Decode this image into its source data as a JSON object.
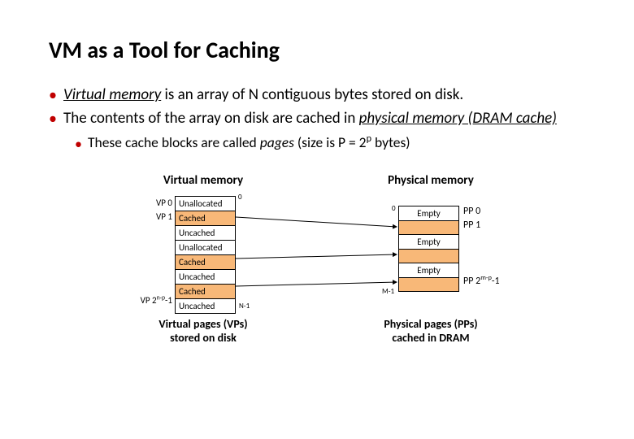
{
  "title": "VM as a Tool for Caching",
  "bullets": {
    "b1_pre": "Virtual memory",
    "b1_post": " is an array of N contiguous bytes stored on disk.",
    "b2_pre": "The contents of the array on disk are cached in ",
    "b2_em": "physical memory (DRAM cache)",
    "sub1_pre": "These cache blocks are called ",
    "sub1_em": "pages",
    "sub1_post": " (size is P = 2",
    "sub1_sup": "p",
    "sub1_end": " bytes)"
  },
  "diagram": {
    "vm_head": "Virtual memory",
    "pm_head": "Physical memory",
    "vp0": "VP 0",
    "vp1": "VP 1",
    "vplast_a": "VP 2",
    "vplast_sup": "n-p",
    "vplast_b": "-1",
    "vm_rows": {
      "r0": "Unallocated",
      "r1": "Cached",
      "r2": "Uncached",
      "r3": "Unallocated",
      "r4": "Cached",
      "r5": "Uncached",
      "r6": "Cached",
      "r7": "Uncached"
    },
    "pm_rows": {
      "r0": "Empty",
      "r2": "Empty",
      "r4": "Empty"
    },
    "pp0": "PP 0",
    "pp1": "PP 1",
    "pplast_a": "PP 2",
    "pplast_sup": "m-p",
    "pplast_b": "-1",
    "zero": "0",
    "n1": "N-1",
    "m1": "M-1",
    "vm_caption_l1": "Virtual pages (VPs)",
    "vm_caption_l2": "stored on disk",
    "pm_caption_l1": "Physical pages (PPs)",
    "pm_caption_l2": "cached in DRAM"
  }
}
